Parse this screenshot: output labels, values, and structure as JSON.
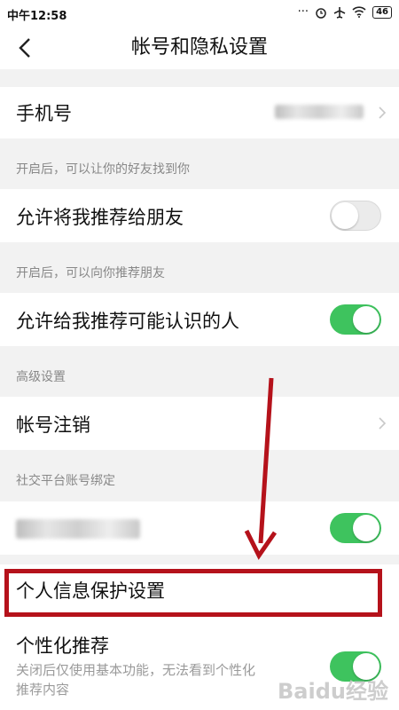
{
  "status_bar": {
    "time": "中午12:58",
    "battery": "46"
  },
  "header": {
    "title": "帐号和隐私设置"
  },
  "rows": {
    "phone_label": "手机号",
    "hint_friends": "开启后，可以让你的好友找到你",
    "recommend_me_label": "允许将我推荐给朋友",
    "hint_recommend": "开启后，可以向你推荐朋友",
    "recommend_known_label": "允许给我推荐可能认识的人",
    "advanced_header": "高级设置",
    "account_cancel_label": "帐号注销",
    "social_header": "社交平台账号绑定",
    "personal_info_label": "个人信息保护设置",
    "personalized_label": "个性化推荐",
    "personalized_desc_line1": "关闭后仅使用基本功能，无法看到个性化",
    "personalized_desc_line2": "推荐内容"
  },
  "toggles": {
    "recommend_me": false,
    "recommend_known": true,
    "social_binding": true,
    "personalized": true
  },
  "watermark": "Baidu经验",
  "colors": {
    "toggle_on": "#3ec35e",
    "highlight": "#b5121b",
    "arrow": "#b5121b"
  }
}
